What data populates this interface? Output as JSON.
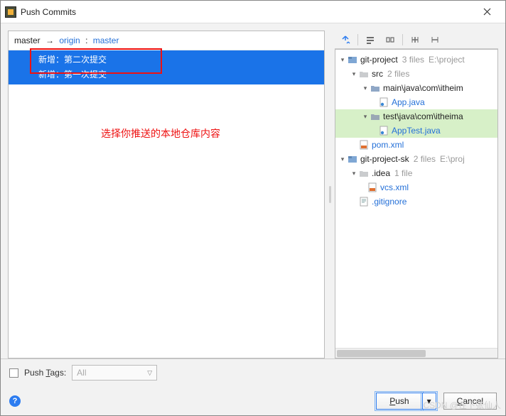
{
  "window": {
    "title": "Push Commits"
  },
  "branch": {
    "local": "master",
    "arrow": "→",
    "remote": "origin",
    "colon": ":",
    "remoteBranch": "master"
  },
  "commits": [
    {
      "label": "新增：第二次提交"
    },
    {
      "label": "新增：第一次提交"
    }
  ],
  "annotation": "选择你推送的本地仓库内容",
  "tree": {
    "n0": {
      "name": "git-project",
      "meta1": "3 files",
      "meta2": "E:\\project"
    },
    "n1": {
      "name": "src",
      "meta1": "2 files"
    },
    "n2": {
      "name": "main\\java\\com\\itheim"
    },
    "n3": {
      "name": "App.java"
    },
    "n4": {
      "name": "test\\java\\com\\itheima"
    },
    "n5": {
      "name": "AppTest.java"
    },
    "n6": {
      "name": "pom.xml"
    },
    "n7": {
      "name": "git-project-sk",
      "meta1": "2 files",
      "meta2": "E:\\proj"
    },
    "n8": {
      "name": ".idea",
      "meta1": "1 file"
    },
    "n9": {
      "name": "vcs.xml"
    },
    "n10": {
      "name": ".gitignore"
    }
  },
  "footer": {
    "pushTagsPrefix": "Push ",
    "pushTagsU": "T",
    "pushTagsSuffix": "ags:",
    "combo": "All",
    "pushU": "P",
    "pushSuffix": "ush",
    "cancelPrefix": "",
    "cancelU": "C",
    "cancelSuffix": "ancel",
    "dropdownGlyph": "▾"
  },
  "watermark": "CSDN @在下张仙人"
}
